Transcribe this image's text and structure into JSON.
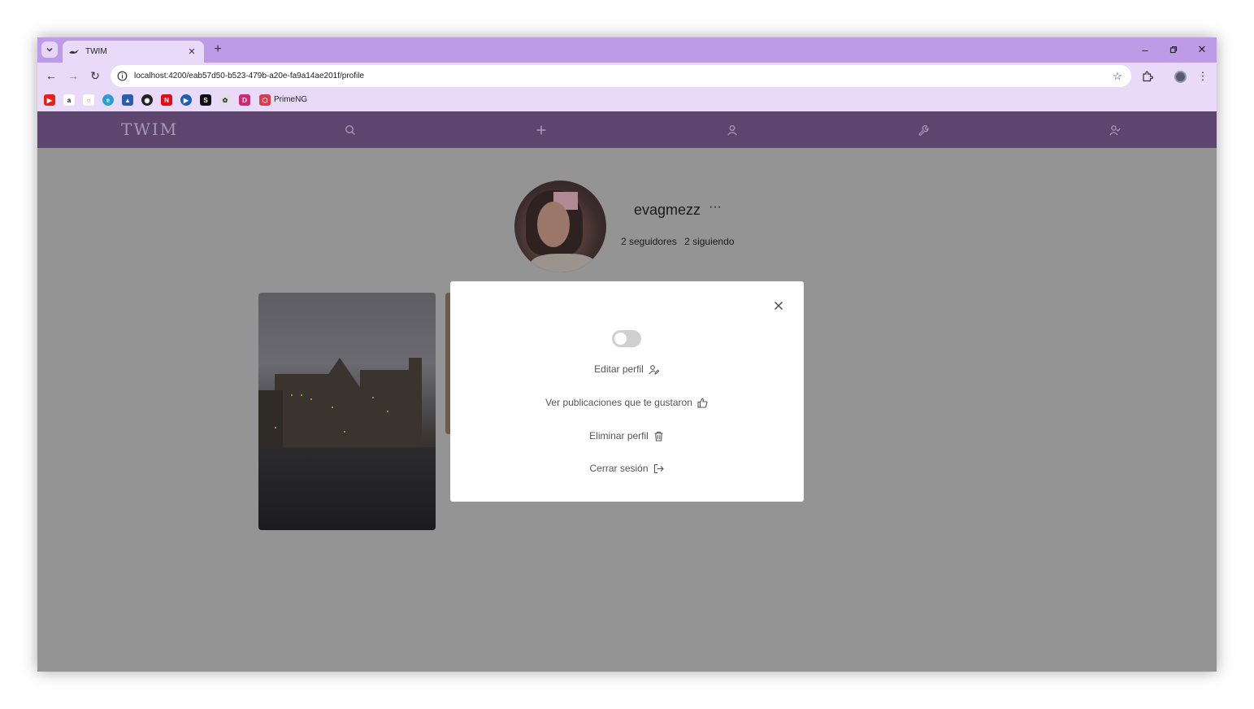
{
  "browser": {
    "tab_title": "TWIM",
    "url": "localhost:4200/eab57d50-b523-479b-a20e-fa9a14ae201f/profile",
    "bookmarks": [
      {
        "icon": "youtube-icon",
        "color": "#e62117",
        "glyph": "▶"
      },
      {
        "icon": "amazon-icon",
        "color": "#ffffff",
        "glyph": "a"
      },
      {
        "icon": "github-icon",
        "color": "#ffffff",
        "glyph": "○"
      },
      {
        "icon": "edge-icon",
        "color": "#2a9fd6",
        "glyph": "e"
      },
      {
        "icon": "education-icon",
        "color": "#2a5db0",
        "glyph": "▲"
      },
      {
        "icon": "globe-icon",
        "color": "#222222",
        "glyph": "◉"
      },
      {
        "icon": "netflix-icon",
        "color": "#e50914",
        "glyph": "N"
      },
      {
        "icon": "play-icon",
        "color": "#1a5fb4",
        "glyph": "▶"
      },
      {
        "icon": "s-icon",
        "color": "#111111",
        "glyph": "S"
      },
      {
        "icon": "openai-icon",
        "color": "#e0e0e0",
        "glyph": "✿"
      },
      {
        "icon": "d-icon",
        "color": "#d6246e",
        "glyph": "D"
      },
      {
        "icon": "primeng-icon",
        "color": "#dd3a4a",
        "glyph": "⬡"
      }
    ],
    "bookmark_label": "PrimeNG"
  },
  "app": {
    "logo": "TWIM",
    "nav_icons": [
      "search-icon",
      "plus-icon",
      "user-icon",
      "wrench-icon",
      "user-check-icon"
    ]
  },
  "profile": {
    "username": "evagmezz",
    "more": "···",
    "followers": "2 seguidores",
    "following": "2 siguiendo"
  },
  "modal": {
    "items": [
      {
        "label": "Editar perfil",
        "icon": "user-edit-icon"
      },
      {
        "label": "Ver publicaciones que te gustaron",
        "icon": "thumbs-up-icon"
      },
      {
        "label": "Eliminar perfil",
        "icon": "trash-icon"
      },
      {
        "label": "Cerrar sesión",
        "icon": "sign-out-icon"
      }
    ]
  },
  "colors": {
    "tabbar": "#bd9be6",
    "toolbar": "#e8daf8",
    "app_nav": "#5e4570",
    "overlay": "#949494"
  }
}
